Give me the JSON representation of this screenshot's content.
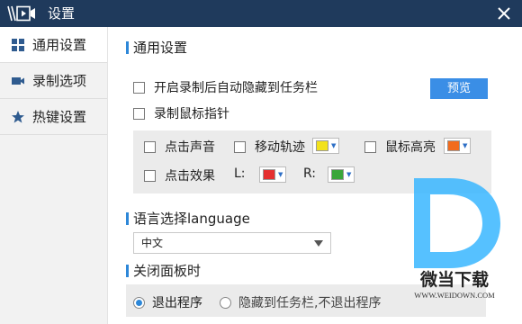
{
  "window": {
    "title": "设置"
  },
  "sidebar": {
    "items": [
      {
        "label": "通用设置"
      },
      {
        "label": "录制选项"
      },
      {
        "label": "热键设置"
      }
    ]
  },
  "general": {
    "title": "通用设置",
    "autohide_label": "开启录制后自动隐藏到任务栏",
    "preview_label": "预览",
    "record_cursor_label": "录制鼠标指针",
    "click_sound_label": "点击声音",
    "move_track_label": "移动轨迹",
    "move_track_color": "#f2e21b",
    "mouse_highlight_label": "鼠标高亮",
    "mouse_highlight_color": "#f26b1d",
    "click_effect_label": "点击效果",
    "left_label": "L:",
    "left_color": "#e53030",
    "right_label": "R:",
    "right_color": "#3aa63a"
  },
  "language": {
    "title": "语言选择language",
    "selected": "中文"
  },
  "close_panel": {
    "title": "关闭面板时",
    "options": [
      {
        "label": "退出程序",
        "selected": true
      },
      {
        "label": "隐藏到任务栏,不退出程序",
        "selected": false
      }
    ]
  },
  "watermark": {
    "brand": "微当下载",
    "url": "WWW.WEIDOWN.COM"
  },
  "accent": "#2d87d8"
}
